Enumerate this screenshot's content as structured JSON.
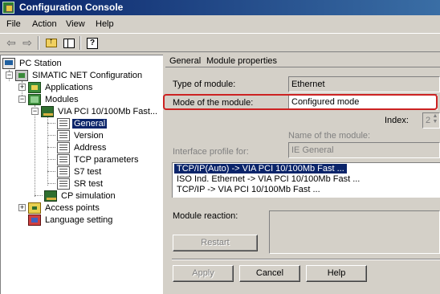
{
  "window": {
    "title": "Configuration Console"
  },
  "menu": [
    {
      "label": "File"
    },
    {
      "label": "Action"
    },
    {
      "label": "View"
    },
    {
      "label": "Help"
    }
  ],
  "toolbar": {
    "back_icon": "back-arrow-icon",
    "forward_icon": "forward-arrow-icon",
    "up_icon": "folder-up-icon",
    "panes_icon": "show-hide-tree-icon",
    "help_icon": "help-icon"
  },
  "tree": {
    "pc_station": "PC Station",
    "simatic": "SIMATIC NET Configuration",
    "applications": "Applications",
    "modules": "Modules",
    "module_card": "VIA PCI 10/100Mb Fast...",
    "general": "General",
    "version": "Version",
    "address": "Address",
    "tcp_parameters": "TCP parameters",
    "s7_test": "S7 test",
    "sr_test": "SR test",
    "cp_simulation": "CP simulation",
    "access_points": "Access points",
    "language_setting": "Language setting"
  },
  "header": {
    "general": "General",
    "module_properties": "Module properties"
  },
  "form": {
    "type_label": "Type of module:",
    "type_value": "Ethernet",
    "mode_label": "Mode of the module:",
    "mode_value": "Configured mode",
    "index_label": "Index:",
    "index_value": "2",
    "name_label": "Name of the module:",
    "profile_label": "Interface profile for:",
    "profile_value": "IE General",
    "profiles": [
      "TCP/IP(Auto) -> VIA PCI 10/100Mb Fast ...",
      "ISO Ind. Ethernet -> VIA PCI 10/100Mb Fast ...",
      "TCP/IP -> VIA PCI 10/100Mb Fast ..."
    ],
    "reaction_label": "Module reaction:",
    "restart_label": "Restart"
  },
  "buttons": {
    "apply": "Apply",
    "cancel": "Cancel",
    "help": "Help"
  },
  "colors": {
    "selection": "#0a246a",
    "highlight": "#cc2222"
  }
}
